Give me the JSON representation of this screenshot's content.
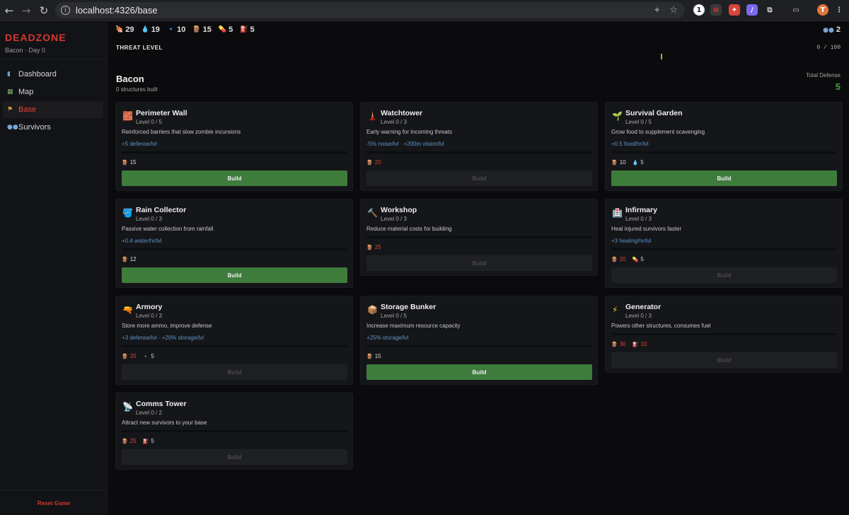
{
  "browser": {
    "url": "localhost:4326/base",
    "profile_initial": "T"
  },
  "sidebar": {
    "brand": "DEADZONE",
    "subtitle": "Bacon · Day 0",
    "items": [
      {
        "label": "Dashboard",
        "icon": "chart-icon"
      },
      {
        "label": "Map",
        "icon": "map-icon"
      },
      {
        "label": "Base",
        "icon": "flag-icon",
        "active": true
      },
      {
        "label": "Survivors",
        "icon": "people-icon"
      }
    ],
    "reset_label": "Reset Game"
  },
  "resources": [
    {
      "name": "food",
      "icon": "🍖",
      "value": "29"
    },
    {
      "name": "water",
      "icon": "💧",
      "value": "19"
    },
    {
      "name": "ammo",
      "icon": "🔹",
      "value": "10"
    },
    {
      "name": "materials",
      "icon": "🪵",
      "value": "15"
    },
    {
      "name": "medicine",
      "icon": "💊",
      "value": "5"
    },
    {
      "name": "fuel",
      "icon": "⛽",
      "value": "5"
    }
  ],
  "survivors_count": "2",
  "threat": {
    "label": "THREAT LEVEL",
    "value_text": "0 / 100"
  },
  "base": {
    "name": "Bacon",
    "built_text": "0 structures built",
    "total_defense_label": "Total Defense",
    "total_defense_value": "5"
  },
  "structures": [
    {
      "name": "Perimeter Wall",
      "icon": "🧱",
      "level": "Level 0 / 5",
      "desc": "Reinforced barriers that slow zombie incursions",
      "effect": "+5 defense/lvl",
      "costs": [
        {
          "icon": "🪵",
          "value": "15",
          "ok": true
        }
      ],
      "button": "Build",
      "enabled": true
    },
    {
      "name": "Watchtower",
      "icon": "🗼",
      "level": "Level 0 / 3",
      "desc": "Early warning for incoming threats",
      "effect": "-5% noise/lvl · +200m vision/lvl",
      "costs": [
        {
          "icon": "🪵",
          "value": "20",
          "ok": false
        }
      ],
      "button": "Build",
      "enabled": false
    },
    {
      "name": "Survival Garden",
      "icon": "🌱",
      "level": "Level 0 / 5",
      "desc": "Grow food to supplement scavenging",
      "effect": "+0.5 food/hr/lvl",
      "costs": [
        {
          "icon": "🪵",
          "value": "10",
          "ok": true
        },
        {
          "icon": "💧",
          "value": "5",
          "ok": true
        }
      ],
      "button": "Build",
      "enabled": true
    },
    {
      "name": "Rain Collector",
      "icon": "🪣",
      "level": "Level 0 / 3",
      "desc": "Passive water collection from rainfall",
      "effect": "+0.4 water/hr/lvl",
      "costs": [
        {
          "icon": "🪵",
          "value": "12",
          "ok": true
        }
      ],
      "button": "Build",
      "enabled": true
    },
    {
      "name": "Workshop",
      "icon": "🔨",
      "level": "Level 0 / 3",
      "desc": "Reduce material costs for building",
      "effect": "",
      "costs": [
        {
          "icon": "🪵",
          "value": "25",
          "ok": false
        }
      ],
      "button": "Build",
      "enabled": false
    },
    {
      "name": "Infirmary",
      "icon": "🏥",
      "level": "Level 0 / 3",
      "desc": "Heal injured survivors faster",
      "effect": "+3 healing/hr/lvl",
      "costs": [
        {
          "icon": "🪵",
          "value": "20",
          "ok": false
        },
        {
          "icon": "💊",
          "value": "5",
          "ok": true
        }
      ],
      "button": "Build",
      "enabled": false
    },
    {
      "name": "Armory",
      "icon": "🔫",
      "level": "Level 0 / 3",
      "desc": "Store more ammo, improve defense",
      "effect": "+3 defense/lvl · +20% storage/lvl",
      "costs": [
        {
          "icon": "🪵",
          "value": "20",
          "ok": false
        },
        {
          "icon": "🔹",
          "value": "5",
          "ok": true
        }
      ],
      "button": "Build",
      "enabled": false
    },
    {
      "name": "Storage Bunker",
      "icon": "📦",
      "level": "Level 0 / 5",
      "desc": "Increase maximum resource capacity",
      "effect": "+25% storage/lvl",
      "costs": [
        {
          "icon": "🪵",
          "value": "15",
          "ok": true
        }
      ],
      "button": "Build",
      "enabled": true
    },
    {
      "name": "Generator",
      "icon": "⚡",
      "level": "Level 0 / 3",
      "desc": "Powers other structures, consumes fuel",
      "effect": "",
      "costs": [
        {
          "icon": "🪵",
          "value": "30",
          "ok": false
        },
        {
          "icon": "⛽",
          "value": "10",
          "ok": false
        }
      ],
      "button": "Build",
      "enabled": false
    },
    {
      "name": "Comms Tower",
      "icon": "📡",
      "level": "Level 0 / 2",
      "desc": "Attract new survivors to your base",
      "effect": "",
      "costs": [
        {
          "icon": "🪵",
          "value": "25",
          "ok": false
        },
        {
          "icon": "⛽",
          "value": "5",
          "ok": true
        }
      ],
      "button": "Build",
      "enabled": false
    }
  ]
}
